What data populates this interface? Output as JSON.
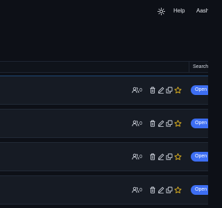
{
  "nav": {
    "help_label": "Help",
    "user_label": "Aash"
  },
  "search": {
    "placeholder": "",
    "button_label": "Search"
  },
  "rows": [
    {
      "member_count": "0",
      "open_label": "Open"
    },
    {
      "member_count": "0",
      "open_label": "Open"
    },
    {
      "member_count": "0",
      "open_label": "Open"
    },
    {
      "member_count": "0",
      "open_label": "Open"
    }
  ],
  "icons": {
    "theme": "sun-icon",
    "members": "users-icon",
    "delete": "trash-icon",
    "edit": "pencil-icon",
    "duplicate": "copy-icon",
    "favorite": "star-icon"
  },
  "colors": {
    "background": "#0d1017",
    "row_background": "#161b24",
    "accent": "#3d6ef2",
    "star": "#e8b81e",
    "selected_border": "#1f4a7a"
  }
}
